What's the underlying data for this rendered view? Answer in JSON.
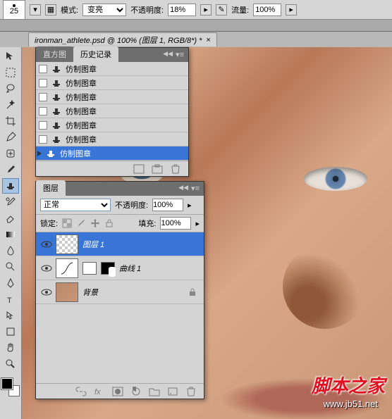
{
  "optionsBar": {
    "brushSize": "25",
    "modeLabel": "模式:",
    "mode": "变亮",
    "opacityLabel": "不透明度:",
    "opacity": "18%",
    "flowLabel": "流量:",
    "flow": "100%"
  },
  "document": {
    "tabTitle": "ironman_athlete.psd @ 100% (图层 1, RGB/8*) *"
  },
  "historyPanel": {
    "tabs": [
      "直方图",
      "历史记录"
    ],
    "activeTab": 1,
    "items": [
      {
        "label": "仿制图章",
        "sel": false
      },
      {
        "label": "仿制图章",
        "sel": false
      },
      {
        "label": "仿制图章",
        "sel": false
      },
      {
        "label": "仿制图章",
        "sel": false
      },
      {
        "label": "仿制图章",
        "sel": false
      },
      {
        "label": "仿制图章",
        "sel": false
      },
      {
        "label": "仿制图章",
        "sel": true
      }
    ]
  },
  "layersPanel": {
    "tab": "图层",
    "blendMode": "正常",
    "opacityLabel": "不透明度:",
    "opacity": "100%",
    "lockLabel": "锁定:",
    "fillLabel": "填充:",
    "fill": "100%",
    "layers": [
      {
        "name": "图层 1",
        "sel": true,
        "type": "transparent"
      },
      {
        "name": "曲线 1",
        "sel": false,
        "type": "curves"
      },
      {
        "name": "背景",
        "sel": false,
        "type": "photo",
        "locked": true
      }
    ]
  },
  "watermark": {
    "main": "脚本之家",
    "sub": "www.jb51.net"
  }
}
